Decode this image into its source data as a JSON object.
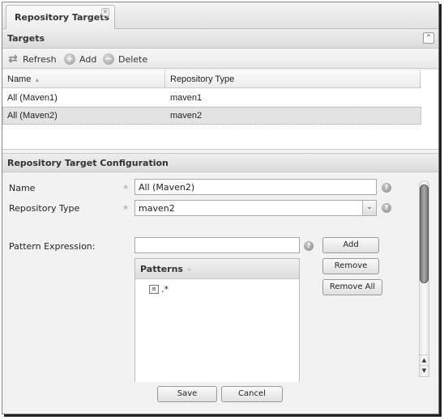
{
  "tab": {
    "title": "Repository Targets",
    "close_glyph": "✕"
  },
  "targets_panel": {
    "title": "Targets",
    "collapse_glyph": "⌃",
    "toolbar": {
      "refresh": "Refresh",
      "add": "Add",
      "delete": "Delete"
    },
    "columns": [
      "Name",
      "Repository Type"
    ],
    "sort_glyph": "▲",
    "rows": [
      {
        "name": "All (Maven1)",
        "type": "maven1",
        "selected": false
      },
      {
        "name": "All (Maven2)",
        "type": "maven2",
        "selected": true
      }
    ]
  },
  "config_panel": {
    "title": "Repository Target Configuration",
    "name_label": "Name",
    "name_value": "All (Maven2)",
    "type_label": "Repository Type",
    "type_value": "maven2",
    "pattern_label": "Pattern Expression:",
    "pattern_value": "",
    "patterns_header": "Patterns",
    "patterns": [
      ".*"
    ],
    "buttons": {
      "add": "Add",
      "remove": "Remove",
      "remove_all": "Remove All",
      "save": "Save",
      "cancel": "Cancel"
    },
    "required_glyph": "★",
    "help_glyph": "?"
  }
}
